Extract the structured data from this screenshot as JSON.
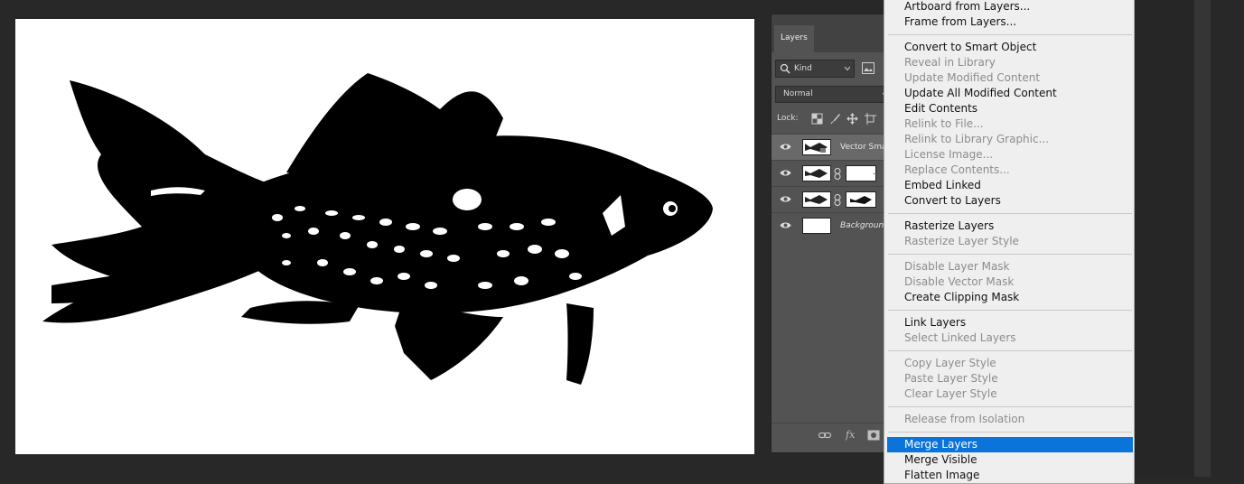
{
  "layers_panel": {
    "tab": "Layers",
    "filter_kind": "Kind",
    "blend_mode": "Normal",
    "lock_label": "Lock:",
    "layers": [
      {
        "name": "Vector Smart Object",
        "selected": true
      },
      {
        "name": "",
        "selected": false
      },
      {
        "name": "",
        "selected": false
      },
      {
        "name": "Background",
        "selected": false
      }
    ],
    "footer_fx": "fx"
  },
  "context_menu": {
    "items": [
      {
        "label": "Artboard from Layers...",
        "enabled": true
      },
      {
        "label": "Frame from Layers...",
        "enabled": true
      },
      {
        "label": "Convert to Smart Object",
        "enabled": true
      },
      {
        "label": "Reveal in Library",
        "enabled": false
      },
      {
        "label": "Update Modified Content",
        "enabled": false
      },
      {
        "label": "Update All Modified Content",
        "enabled": true
      },
      {
        "label": "Edit Contents",
        "enabled": true
      },
      {
        "label": "Relink to File...",
        "enabled": false
      },
      {
        "label": "Relink to Library Graphic...",
        "enabled": false
      },
      {
        "label": "License Image...",
        "enabled": false
      },
      {
        "label": "Replace Contents...",
        "enabled": false
      },
      {
        "label": "Embed Linked",
        "enabled": true
      },
      {
        "label": "Convert to Layers",
        "enabled": true
      },
      {
        "label": "Rasterize Layers",
        "enabled": true
      },
      {
        "label": "Rasterize Layer Style",
        "enabled": false
      },
      {
        "label": "Disable Layer Mask",
        "enabled": false
      },
      {
        "label": "Disable Vector Mask",
        "enabled": false
      },
      {
        "label": "Create Clipping Mask",
        "enabled": true
      },
      {
        "label": "Link Layers",
        "enabled": true
      },
      {
        "label": "Select Linked Layers",
        "enabled": false
      },
      {
        "label": "Copy Layer Style",
        "enabled": false
      },
      {
        "label": "Paste Layer Style",
        "enabled": false
      },
      {
        "label": "Clear Layer Style",
        "enabled": false
      },
      {
        "label": "Release from Isolation",
        "enabled": false
      },
      {
        "label": "Merge Layers",
        "enabled": true,
        "highlighted": true
      },
      {
        "label": "Merge Visible",
        "enabled": true
      },
      {
        "label": "Flatten Image",
        "enabled": true
      }
    ]
  },
  "colors": {
    "workspace": "#282828",
    "panel": "#535353",
    "menu_bg": "#efefef",
    "highlight": "#0a74da"
  }
}
